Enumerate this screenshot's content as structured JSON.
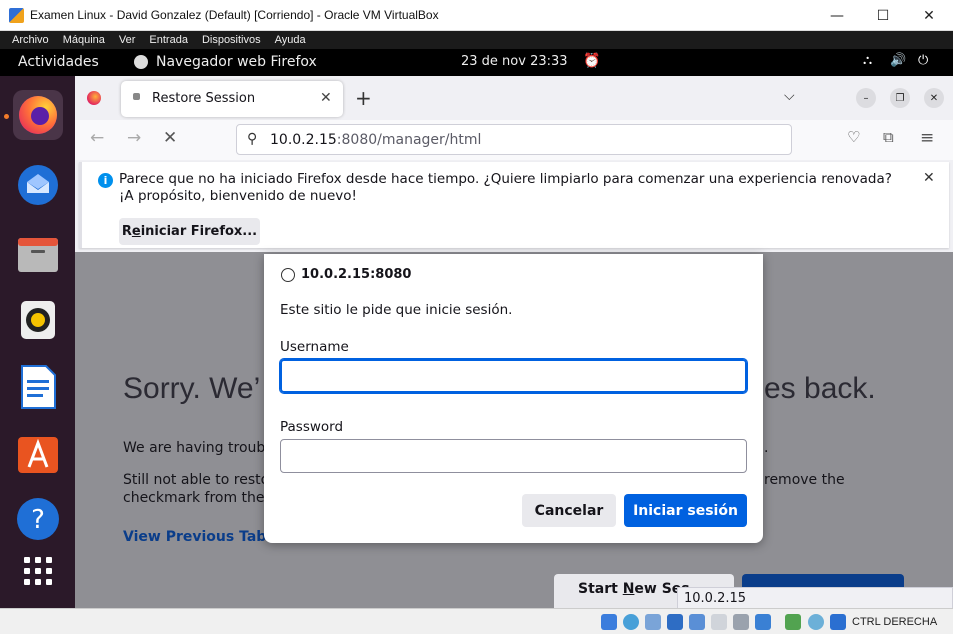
{
  "window": {
    "title": "Examen Linux - David Gonzalez (Default) [Corriendo] - Oracle VM VirtualBox",
    "minimize": "—",
    "maximize": "☐",
    "close": "✕"
  },
  "vbox_menu": [
    "Archivo",
    "Máquina",
    "Ver",
    "Entrada",
    "Dispositivos",
    "Ayuda"
  ],
  "gnome": {
    "activities": "Actividades",
    "app_name": "Navegador web Firefox",
    "clock": "23 de nov  23:33"
  },
  "browser": {
    "tab_label": "Restore Session",
    "url_host": "10.0.2.15",
    "url_rest": ":8080/manager/html",
    "notification": {
      "message": "Parece que no ha iniciado Firefox desde hace tiempo. ¿Quiere limpiarlo para comenzar una experiencia renovada? ¡A propósito, bienvenido de nuevo!",
      "button_prefix": "R",
      "button_u": "e",
      "button_rest": "iniciar Firefox..."
    },
    "page": {
      "headline_left": "Sorry. We’",
      "headline_right": "es back.",
      "p1_left": "We are having troubl",
      "p1_right": ".",
      "p2_left": "Still not able to resto",
      "p2_right": "remove the",
      "p3_left": "checkmark from the",
      "link": "View Previous Tabs",
      "start_new_1": "Start ",
      "start_new_u": "N",
      "start_new_2": "ew Ses"
    },
    "status_url": "10.0.2.15"
  },
  "dialog": {
    "host": "10.0.2.15:8080",
    "subtitle": "Este sitio le pide que inicie sesión.",
    "username_label": "Username",
    "username_value": "",
    "password_label": "Password",
    "password_value": "",
    "cancel": "Cancelar",
    "submit": "Iniciar sesión"
  },
  "vbox_status": {
    "host_key": "CTRL DERECHA"
  },
  "colors": {
    "accent": "#0061e0",
    "dock": "#2b1929",
    "focus_border": "#0061e0"
  }
}
